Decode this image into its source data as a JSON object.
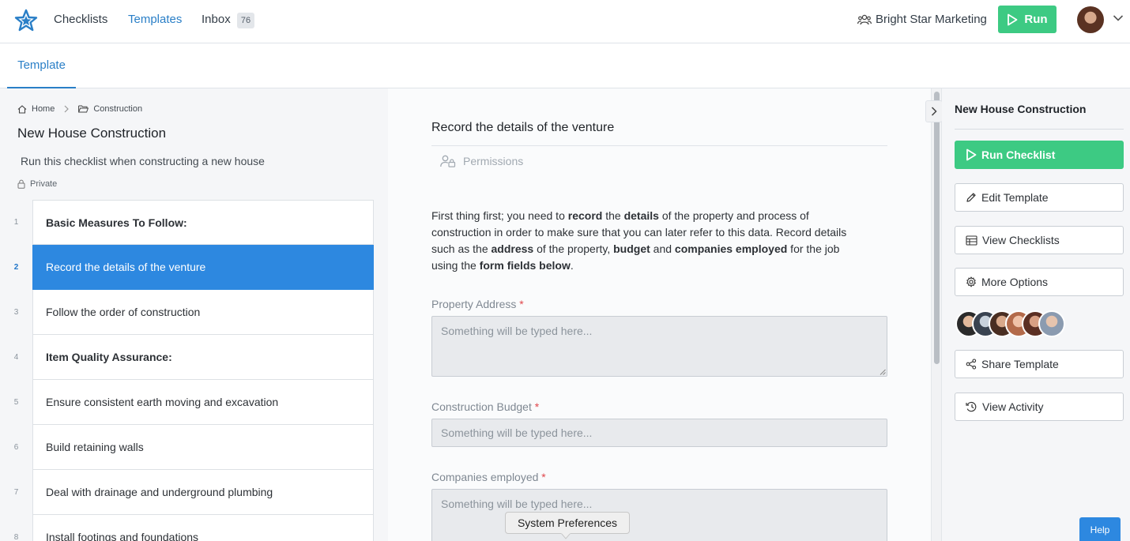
{
  "nav": {
    "links": [
      "Checklists",
      "Templates",
      "Inbox"
    ],
    "active_link": "Templates",
    "inbox_count": "76",
    "org_name": "Bright Star Marketing",
    "run_label": "Run"
  },
  "tabs": {
    "active": "Template"
  },
  "breadcrumb": {
    "home": "Home",
    "folder": "Construction"
  },
  "template": {
    "title": "New House Construction",
    "description": "Run this checklist when constructing a new house",
    "privacy": "Private"
  },
  "tasks": [
    {
      "num": "1",
      "label": "Basic Measures To Follow:",
      "heading": true
    },
    {
      "num": "2",
      "label": "Record the details of the venture",
      "active": true
    },
    {
      "num": "3",
      "label": "Follow the order of construction"
    },
    {
      "num": "4",
      "label": "Item Quality Assurance:",
      "heading": true
    },
    {
      "num": "5",
      "label": "Ensure consistent earth moving and excavation"
    },
    {
      "num": "6",
      "label": "Build retaining walls"
    },
    {
      "num": "7",
      "label": "Deal with drainage and underground plumbing"
    },
    {
      "num": "8",
      "label": "Install footings and foundations"
    }
  ],
  "task_detail": {
    "title": "Record the details of the venture",
    "permissions_label": "Permissions",
    "body": {
      "t1": "First thing first; you need to ",
      "b1": "record",
      "t2": " the ",
      "b2": "details",
      "t3": " of the property and process of construction in order to make sure that you can later refer to this data. Record details such as the ",
      "b3": "address",
      "t4": " of the property, ",
      "b4": "budget",
      "t5": " and ",
      "b5": "companies employed",
      "t6": " for the job using the ",
      "b6": "form fields below",
      "t7": "."
    },
    "fields": [
      {
        "label": "Property Address",
        "required_mark": "*",
        "placeholder": "Something will be typed here..."
      },
      {
        "label": "Construction Budget",
        "required_mark": "*",
        "placeholder": "Something will be typed here..."
      },
      {
        "label": "Companies employed",
        "required_mark": "*",
        "placeholder": "Something will be typed here..."
      }
    ]
  },
  "tooltip": "System Preferences",
  "sidebar": {
    "title": "New House Construction",
    "buttons": {
      "run": "Run Checklist",
      "edit": "Edit Template",
      "view_checklists": "View Checklists",
      "more": "More Options",
      "share": "Share Template",
      "activity": "View Activity"
    }
  },
  "help_label": "Help",
  "colors": {
    "primary_blue": "#2d88e0",
    "link_blue": "#2a7fc7",
    "run_green": "#3dca83",
    "required_red": "#e0464b"
  }
}
